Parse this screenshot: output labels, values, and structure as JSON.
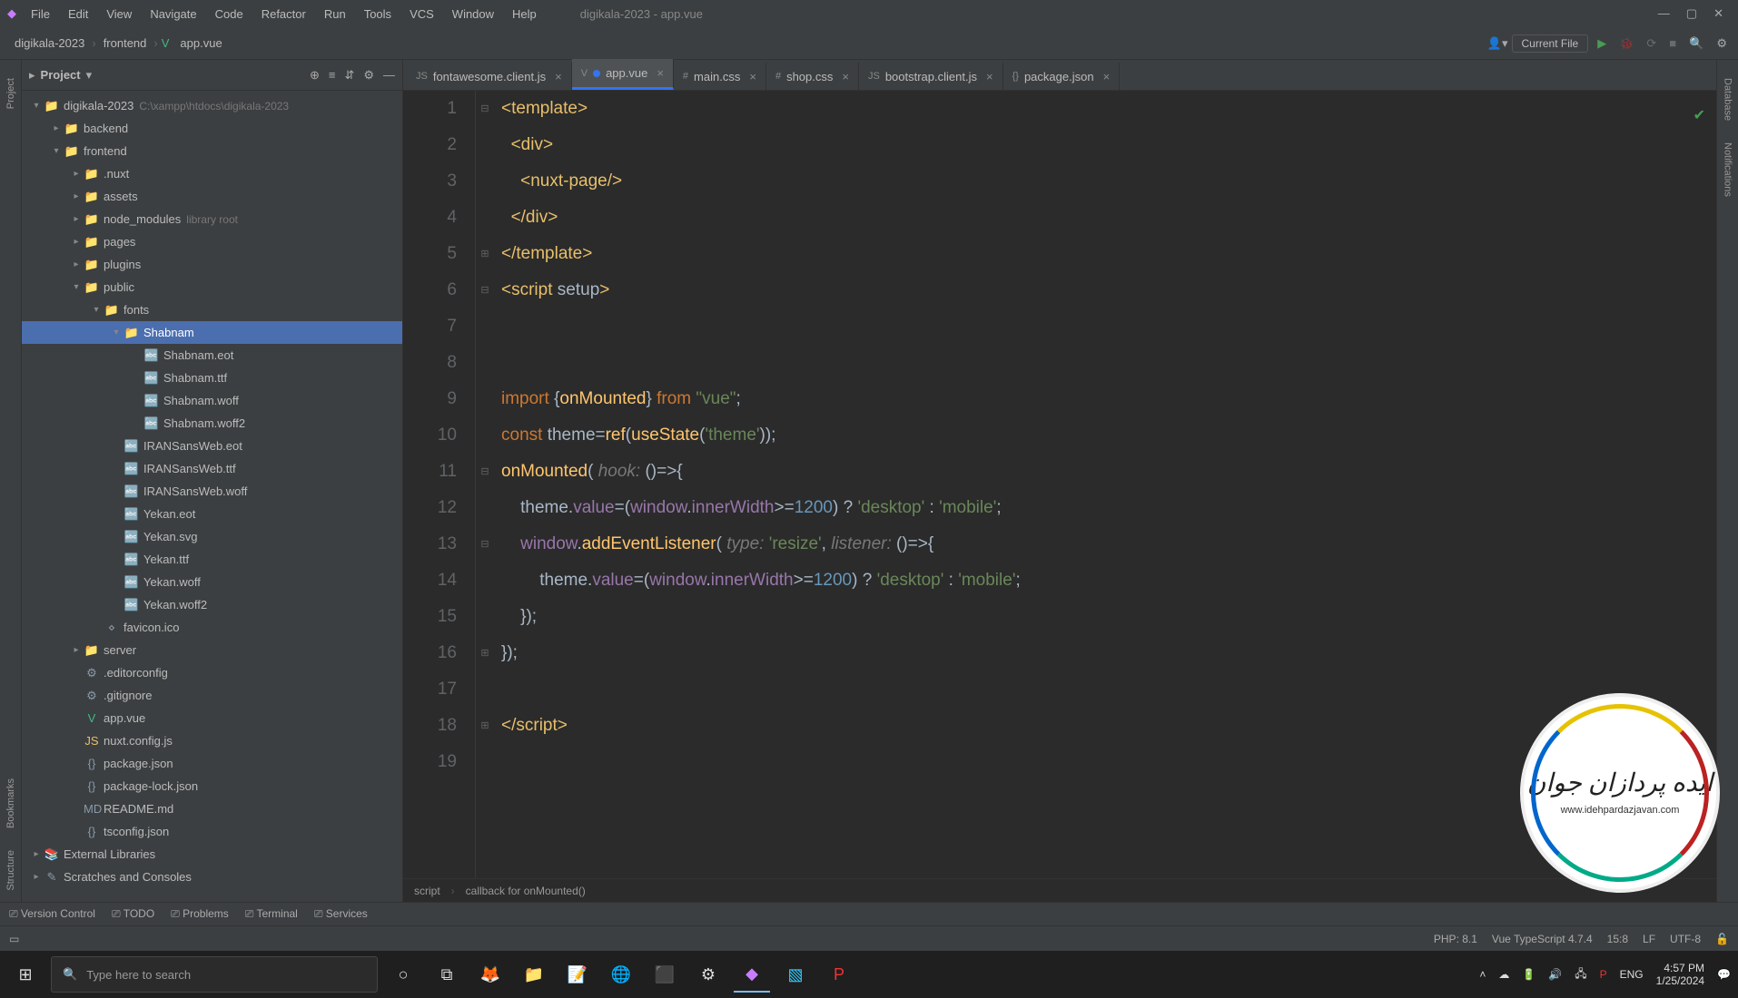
{
  "app": {
    "title": "digikala-2023 - app.vue"
  },
  "menu": [
    "File",
    "Edit",
    "View",
    "Navigate",
    "Code",
    "Refactor",
    "Run",
    "Tools",
    "VCS",
    "Window",
    "Help"
  ],
  "nav": {
    "crumbs": [
      "digikala-2023",
      "frontend",
      "app.vue"
    ],
    "runconfig": "Current File"
  },
  "projectPane": {
    "title": "Project"
  },
  "tree": [
    {
      "d": 0,
      "chev": "▾",
      "icon": "📁",
      "label": "digikala-2023",
      "dim": "C:\\xampp\\htdocs\\digikala-2023",
      "cls": "foldericon"
    },
    {
      "d": 1,
      "chev": "▸",
      "icon": "📁",
      "label": "backend",
      "cls": "foldericon"
    },
    {
      "d": 1,
      "chev": "▾",
      "icon": "📁",
      "label": "frontend",
      "cls": "foldericon"
    },
    {
      "d": 2,
      "chev": "▸",
      "icon": "📁",
      "label": ".nuxt",
      "cls": "foldericon"
    },
    {
      "d": 2,
      "chev": "▸",
      "icon": "📁",
      "label": "assets",
      "cls": "foldericon"
    },
    {
      "d": 2,
      "chev": "▸",
      "icon": "📁",
      "label": "node_modules",
      "dim": "library root",
      "cls": "foldericon"
    },
    {
      "d": 2,
      "chev": "▸",
      "icon": "📁",
      "label": "pages",
      "cls": "foldericon"
    },
    {
      "d": 2,
      "chev": "▸",
      "icon": "📁",
      "label": "plugins",
      "cls": "foldericon"
    },
    {
      "d": 2,
      "chev": "▾",
      "icon": "📁",
      "label": "public",
      "cls": "foldericon"
    },
    {
      "d": 3,
      "chev": "▾",
      "icon": "📁",
      "label": "fonts",
      "cls": "foldericon"
    },
    {
      "d": 4,
      "chev": "▾",
      "icon": "📁",
      "label": "Shabnam",
      "cls": "foldericon",
      "sel": true
    },
    {
      "d": 5,
      "chev": "",
      "icon": "🔤",
      "label": "Shabnam.eot",
      "cls": "fileicon"
    },
    {
      "d": 5,
      "chev": "",
      "icon": "🔤",
      "label": "Shabnam.ttf",
      "cls": "fileicon"
    },
    {
      "d": 5,
      "chev": "",
      "icon": "🔤",
      "label": "Shabnam.woff",
      "cls": "fileicon"
    },
    {
      "d": 5,
      "chev": "",
      "icon": "🔤",
      "label": "Shabnam.woff2",
      "cls": "fileicon"
    },
    {
      "d": 4,
      "chev": "",
      "icon": "🔤",
      "label": "IRANSansWeb.eot",
      "cls": "fileicon"
    },
    {
      "d": 4,
      "chev": "",
      "icon": "🔤",
      "label": "IRANSansWeb.ttf",
      "cls": "fileicon"
    },
    {
      "d": 4,
      "chev": "",
      "icon": "🔤",
      "label": "IRANSansWeb.woff",
      "cls": "fileicon"
    },
    {
      "d": 4,
      "chev": "",
      "icon": "🔤",
      "label": "Yekan.eot",
      "cls": "fileicon"
    },
    {
      "d": 4,
      "chev": "",
      "icon": "🔤",
      "label": "Yekan.svg",
      "cls": "fileicon"
    },
    {
      "d": 4,
      "chev": "",
      "icon": "🔤",
      "label": "Yekan.ttf",
      "cls": "fileicon"
    },
    {
      "d": 4,
      "chev": "",
      "icon": "🔤",
      "label": "Yekan.woff",
      "cls": "fileicon"
    },
    {
      "d": 4,
      "chev": "",
      "icon": "🔤",
      "label": "Yekan.woff2",
      "cls": "fileicon"
    },
    {
      "d": 3,
      "chev": "",
      "icon": "⋄",
      "label": "favicon.ico",
      "cls": "fileicon"
    },
    {
      "d": 2,
      "chev": "▸",
      "icon": "📁",
      "label": "server",
      "cls": "foldericon"
    },
    {
      "d": 2,
      "chev": "",
      "icon": "⚙",
      "label": ".editorconfig",
      "cls": "fileicon"
    },
    {
      "d": 2,
      "chev": "",
      "icon": "⚙",
      "label": ".gitignore",
      "cls": "fileicon"
    },
    {
      "d": 2,
      "chev": "",
      "icon": "V",
      "label": "app.vue",
      "cls": "vueicon"
    },
    {
      "d": 2,
      "chev": "",
      "icon": "JS",
      "label": "nuxt.config.js",
      "cls": "jsicon"
    },
    {
      "d": 2,
      "chev": "",
      "icon": "{}",
      "label": "package.json",
      "cls": "fileicon"
    },
    {
      "d": 2,
      "chev": "",
      "icon": "{}",
      "label": "package-lock.json",
      "cls": "fileicon"
    },
    {
      "d": 2,
      "chev": "",
      "icon": "MD",
      "label": "README.md",
      "cls": "fileicon"
    },
    {
      "d": 2,
      "chev": "",
      "icon": "{}",
      "label": "tsconfig.json",
      "cls": "fileicon"
    },
    {
      "d": 0,
      "chev": "▸",
      "icon": "📚",
      "label": "External Libraries",
      "cls": "fileicon"
    },
    {
      "d": 0,
      "chev": "▸",
      "icon": "✎",
      "label": "Scratches and Consoles",
      "cls": "fileicon"
    }
  ],
  "tabs": [
    {
      "label": "fontawesome.client.js",
      "icon": "JS",
      "active": false,
      "mod": false
    },
    {
      "label": "app.vue",
      "icon": "V",
      "active": true,
      "mod": true
    },
    {
      "label": "main.css",
      "icon": "#",
      "active": false,
      "mod": false
    },
    {
      "label": "shop.css",
      "icon": "#",
      "active": false,
      "mod": false
    },
    {
      "label": "bootstrap.client.js",
      "icon": "JS",
      "active": false,
      "mod": false
    },
    {
      "label": "package.json",
      "icon": "{}",
      "active": false,
      "mod": false
    }
  ],
  "code": {
    "lines": [
      "1",
      "2",
      "3",
      "4",
      "5",
      "6",
      "7",
      "8",
      "9",
      "10",
      "11",
      "12",
      "13",
      "14",
      "15",
      "16",
      "17",
      "18",
      "19"
    ]
  },
  "breadcrumb": {
    "a": "script",
    "b": "callback for onMounted()"
  },
  "bottomTools": [
    "Version Control",
    "TODO",
    "Problems",
    "Terminal",
    "Services"
  ],
  "status": {
    "php": "PHP: 8.1",
    "ts": "Vue TypeScript 4.7.4",
    "pos": "15:8",
    "le": "LF",
    "enc": "UTF-8"
  },
  "leftRail": [
    "Project",
    "Bookmarks",
    "Structure"
  ],
  "rightRail": [
    "Database",
    "Notifications"
  ],
  "taskbar": {
    "searchPlaceholder": "Type here to search",
    "tray": {
      "lang": "ENG",
      "time": "4:57 PM",
      "date": "1/25/2024"
    }
  },
  "watermark": {
    "text": "ایده پردازان جوان",
    "url": "www.idehpardazjavan.com"
  }
}
